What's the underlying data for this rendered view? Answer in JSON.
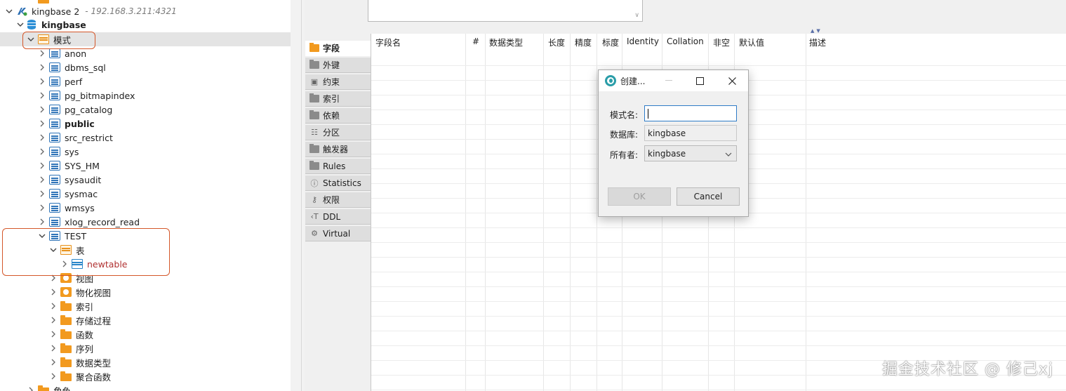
{
  "tree": {
    "connection": {
      "label": "kingbase 2",
      "host": "- 192.168.3.211:4321"
    },
    "database": {
      "label": "kingbase"
    },
    "schemas_folder": {
      "label": "模式"
    },
    "schemas": [
      {
        "label": "anon",
        "bold": false
      },
      {
        "label": "dbms_sql",
        "bold": false
      },
      {
        "label": "perf",
        "bold": false
      },
      {
        "label": "pg_bitmapindex",
        "bold": false
      },
      {
        "label": "pg_catalog",
        "bold": false
      },
      {
        "label": "public",
        "bold": true
      },
      {
        "label": "src_restrict",
        "bold": false
      },
      {
        "label": "sys",
        "bold": false
      },
      {
        "label": "SYS_HM",
        "bold": false
      },
      {
        "label": "sysaudit",
        "bold": false
      },
      {
        "label": "sysmac",
        "bold": false
      },
      {
        "label": "wmsys",
        "bold": false
      },
      {
        "label": "xlog_record_read",
        "bold": false
      }
    ],
    "test_schema": {
      "label": "TEST",
      "tables_folder": "表",
      "table": "newtable",
      "children": [
        {
          "label": "视图",
          "icon": "view-folder-icon"
        },
        {
          "label": "物化视图",
          "icon": "materialized-view-folder-icon"
        },
        {
          "label": "索引",
          "icon": "folder-icon"
        },
        {
          "label": "存储过程",
          "icon": "folder-icon"
        },
        {
          "label": "函数",
          "icon": "folder-icon"
        },
        {
          "label": "序列",
          "icon": "folder-icon"
        },
        {
          "label": "数据类型",
          "icon": "folder-icon"
        },
        {
          "label": "聚合函数",
          "icon": "folder-icon"
        }
      ]
    },
    "roles": {
      "label": "角色"
    }
  },
  "editor": {
    "side_tabs": [
      {
        "label": "字段",
        "icon": "columns-icon",
        "active": true
      },
      {
        "label": "外键",
        "icon": "folder-icon",
        "active": false
      },
      {
        "label": "约束",
        "icon": "constraint-icon",
        "active": false
      },
      {
        "label": "索引",
        "icon": "folder-icon",
        "active": false
      },
      {
        "label": "依赖",
        "icon": "folder-icon",
        "active": false
      },
      {
        "label": "分区",
        "icon": "partition-icon",
        "active": false
      },
      {
        "label": "触发器",
        "icon": "folder-icon",
        "active": false
      },
      {
        "label": "Rules",
        "icon": "folder-icon",
        "active": false
      },
      {
        "label": "Statistics",
        "icon": "info-icon",
        "active": false
      },
      {
        "label": "权限",
        "icon": "key-icon",
        "active": false
      },
      {
        "label": "DDL",
        "icon": "ddl-icon",
        "active": false
      },
      {
        "label": "Virtual",
        "icon": "virtual-icon",
        "active": false
      }
    ],
    "columns": [
      "字段名",
      "#",
      "数据类型",
      "长度",
      "精度",
      "标度",
      "Identity",
      "Collation",
      "非空",
      "默认值",
      "描述"
    ]
  },
  "dialog": {
    "title": "创建...",
    "fields": {
      "schema_name": {
        "label": "模式名:",
        "value": ""
      },
      "database": {
        "label": "数据库:",
        "value": "kingbase"
      },
      "owner": {
        "label": "所有者:",
        "value": "kingbase"
      }
    },
    "ok_label": "OK",
    "cancel_label": "Cancel"
  },
  "watermark": "掘金技术社区 @ 修己xj",
  "colors": {
    "highlight_box": "#d4572a",
    "accent": "#2f7cc7",
    "table_label": "#b03030"
  }
}
